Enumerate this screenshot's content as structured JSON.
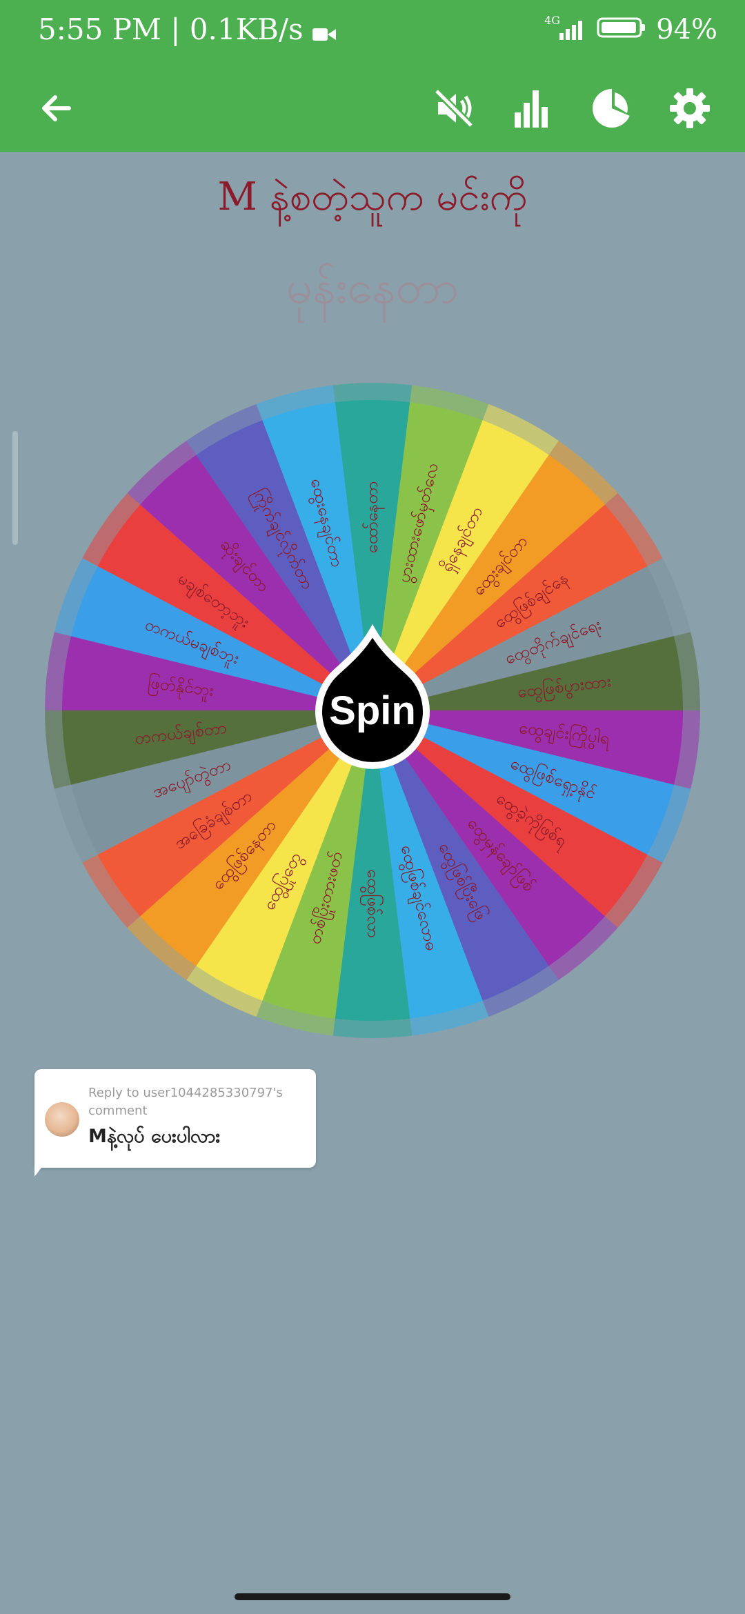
{
  "status_bar": {
    "time": "5:55 PM",
    "network_speed": "0.1KB/s",
    "network_type": "4G",
    "battery": "94%",
    "icons": [
      "video-camera-icon",
      "signal-icon",
      "battery-icon"
    ]
  },
  "app_bar": {
    "icons": [
      "back-arrow-icon",
      "mute-icon",
      "bar-chart-icon",
      "pie-chart-icon",
      "gear-icon"
    ]
  },
  "header": {
    "title": "M နဲ့စတဲ့သူက မင်းကို",
    "subtitle": "မုန်းနေတာ"
  },
  "wheel": {
    "spin_label": "Spin",
    "segments": [
      {
        "label": "ထော်နေတာ",
        "color": "#28a79a"
      },
      {
        "label": "ပွားထားဖော်မှတ်လေ",
        "color": "#8bc34a"
      },
      {
        "label": "ရှိနေချင်တာ",
        "color": "#f6e44b"
      },
      {
        "label": "ထွေးချင်တာ",
        "color": "#f39c25"
      },
      {
        "label": "ထွေဖြစ်ချင်နေ",
        "color": "#f05a38"
      },
      {
        "label": "ထွေတိုက်ချင်ရေး",
        "color": "#7d949e"
      },
      {
        "label": "ထွေဖြစ်ပွားထား",
        "color": "#556f3d"
      },
      {
        "label": "ထွေချင်းကြိုပွါရ",
        "color": "#9b2fae"
      },
      {
        "label": "ထွေဖြစ်ရှော့နိုင်",
        "color": "#3a9ee8"
      },
      {
        "label": "ထွေခဲ့ကိုဖြစ်ရ",
        "color": "#e9403f"
      },
      {
        "label": "ထွေမှန်ချော်ဖြစ်",
        "color": "#9b2fae"
      },
      {
        "label": "ထွေဖြစ်ပြီးဖြေ",
        "color": "#5e5ec0"
      },
      {
        "label": "ထွေဖြစ်ချင်လောဓ",
        "color": "#37aee8"
      },
      {
        "label": "ထွေဖြစ်လာ",
        "color": "#28a79a"
      },
      {
        "label": "တစ်ပြိုးတားဖတ်",
        "color": "#8bc34a"
      },
      {
        "label": "ထွေ့ပြုတွေ",
        "color": "#f6e44b"
      },
      {
        "label": "ထွေဖြစ်နေတာ",
        "color": "#f39c25"
      },
      {
        "label": "အခြေခံချစ်တာ",
        "color": "#f05a38"
      },
      {
        "label": "အပျော်တွဲတာ",
        "color": "#7d949e"
      },
      {
        "label": "တကယ်ချစ်တာ",
        "color": "#556f3d"
      },
      {
        "label": "ဖြတ်နိုင်ဘူး",
        "color": "#9b2fae"
      },
      {
        "label": "တကယ်မချစ်ဘူး",
        "color": "#3a9ee8"
      },
      {
        "label": "မချစ်တော့ဘူး",
        "color": "#e9403f"
      },
      {
        "label": "ဆိုးချင်တာ",
        "color": "#9b2fae"
      },
      {
        "label": "ကြိုက်ချင်လိုက်တာ",
        "color": "#5e5ec0"
      },
      {
        "label": "ထွေးနေချင်တာ",
        "color": "#37aee8"
      }
    ]
  },
  "comment": {
    "reply_to": "Reply to user1044285330797's comment",
    "text": "Mနဲ့လုပ် ပေးပါလား"
  }
}
